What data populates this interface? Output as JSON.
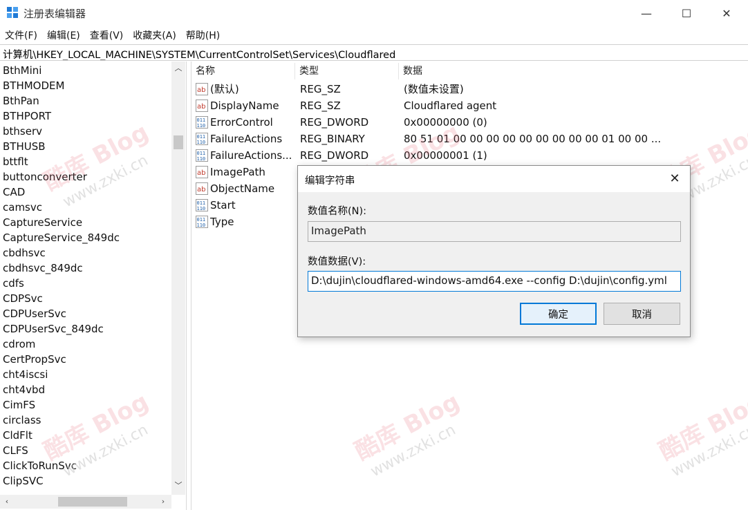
{
  "window": {
    "title": "注册表编辑器",
    "minimize_glyph": "—",
    "maximize_glyph": "☐",
    "close_glyph": "✕"
  },
  "menu": [
    "文件(F)",
    "编辑(E)",
    "查看(V)",
    "收藏夹(A)",
    "帮助(H)"
  ],
  "address": "计算机\\HKEY_LOCAL_MACHINE\\SYSTEM\\CurrentControlSet\\Services\\Cloudflared",
  "tree": {
    "items": [
      "BthMini",
      "BTHMODEM",
      "BthPan",
      "BTHPORT",
      "bthserv",
      "BTHUSB",
      "bttflt",
      "buttonconverter",
      "CAD",
      "camsvc",
      "CaptureService",
      "CaptureService_849dc",
      "cbdhsvc",
      "cbdhsvc_849dc",
      "cdfs",
      "CDPSvc",
      "CDPUserSvc",
      "CDPUserSvc_849dc",
      "cdrom",
      "CertPropSvc",
      "cht4iscsi",
      "cht4vbd",
      "CimFS",
      "circlass",
      "CldFlt",
      "CLFS",
      "ClickToRunSvc",
      "ClipSVC"
    ]
  },
  "list": {
    "columns": [
      "名称",
      "类型",
      "数据"
    ],
    "rows": [
      {
        "icon": "string-value-icon",
        "name": "(默认)",
        "type": "REG_SZ",
        "data": "(数值未设置)"
      },
      {
        "icon": "string-value-icon",
        "name": "DisplayName",
        "type": "REG_SZ",
        "data": "Cloudflared agent"
      },
      {
        "icon": "dword-value-icon",
        "name": "ErrorControl",
        "type": "REG_DWORD",
        "data": "0x00000000 (0)"
      },
      {
        "icon": "dword-value-icon",
        "name": "FailureActions",
        "type": "REG_BINARY",
        "data": "80 51 01 00 00 00 00 00 00 00 00 00 01 00 00 ..."
      },
      {
        "icon": "dword-value-icon",
        "name": "FailureActions...",
        "type": "REG_DWORD",
        "data": "0x00000001 (1)"
      },
      {
        "icon": "string-value-icon",
        "name": "ImagePath",
        "type": "",
        "data": ""
      },
      {
        "icon": "string-value-icon",
        "name": "ObjectName",
        "type": "",
        "data": ""
      },
      {
        "icon": "dword-value-icon",
        "name": "Start",
        "type": "",
        "data": ""
      },
      {
        "icon": "dword-value-icon",
        "name": "Type",
        "type": "",
        "data": ""
      }
    ]
  },
  "dialog": {
    "title": "编辑字符串",
    "close_glyph": "✕",
    "name_label": "数值名称(N):",
    "name_value": "ImagePath",
    "data_label": "数值数据(V):",
    "data_value": "D:\\dujin\\cloudflared-windows-amd64.exe --config D:\\dujin\\config.yml",
    "ok_label": "确定",
    "cancel_label": "取消"
  },
  "watermark": {
    "brand": "酷库 Blog",
    "url": "www.zxki.cn"
  },
  "colors": {
    "accent": "#0078d7",
    "string_icon": "#c0392b",
    "dword_icon": "#1f5fa8"
  }
}
